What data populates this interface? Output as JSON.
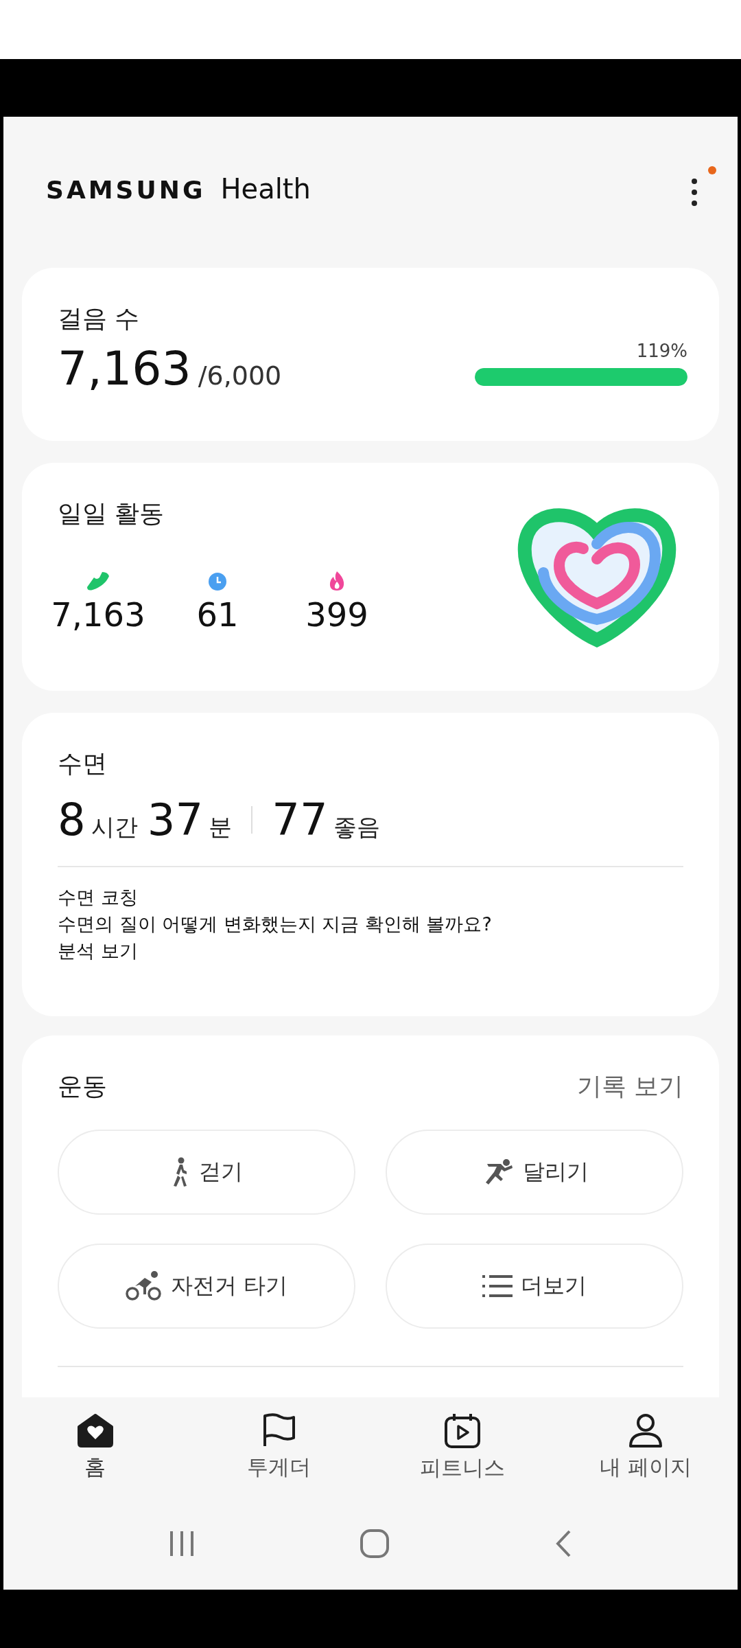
{
  "header": {
    "brand": "SAMSUNG",
    "app_name": "Health",
    "has_notification": true
  },
  "steps": {
    "title": "걸음 수",
    "value": "7,163",
    "goal": "/6,000",
    "percent": "119%",
    "level": 1
  },
  "daily_activity": {
    "title": "일일 활동",
    "stats": [
      {
        "kind": "steps",
        "value": "7,163",
        "color": "#1fc46a"
      },
      {
        "kind": "time",
        "value": "61",
        "color": "#4a9ff0"
      },
      {
        "kind": "calories",
        "value": "399",
        "color": "#f0479a"
      }
    ]
  },
  "sleep": {
    "title": "수면",
    "hours": "8",
    "hours_unit": "시간",
    "minutes": "37",
    "minutes_unit": "분",
    "score": "77",
    "score_label": "좋음",
    "coaching_title": "수면 코칭",
    "coaching_text": "수면의 질이 어떻게 변화했는지 지금 확인해 볼까요?",
    "coaching_link": "분석 보기"
  },
  "exercise": {
    "title": "운동",
    "history_link": "기록 보기",
    "buttons": [
      {
        "kind": "walk",
        "label": "걷기"
      },
      {
        "kind": "run",
        "label": "달리기"
      },
      {
        "kind": "bike",
        "label": "자전거 타기"
      },
      {
        "kind": "more",
        "label": "더보기"
      }
    ]
  },
  "bottom_nav": [
    {
      "kind": "home",
      "label": "홈",
      "selected": true
    },
    {
      "kind": "together",
      "label": "투게더",
      "selected": false
    },
    {
      "kind": "fitness",
      "label": "피트니스",
      "selected": false
    },
    {
      "kind": "mypage",
      "label": "내 페이지",
      "selected": false
    }
  ]
}
